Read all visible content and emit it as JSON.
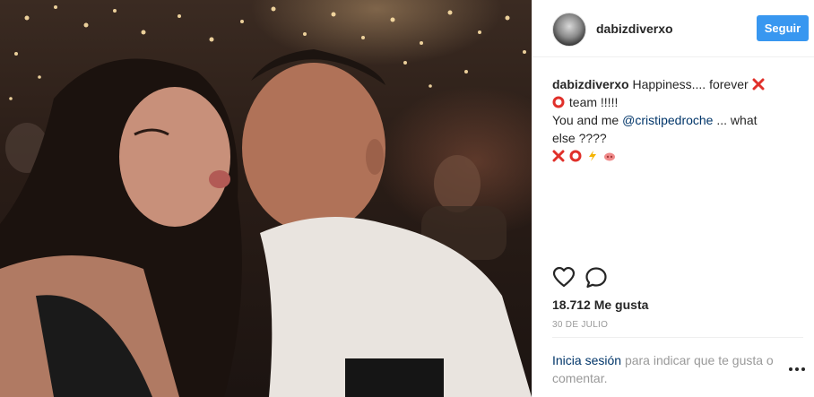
{
  "post": {
    "username": "dabizdiverxo",
    "follow_label": "Seguir",
    "caption": {
      "username": "dabizdiverxo",
      "text_1": "Happiness.... forever",
      "text_2": "team !!!!!",
      "text_3": "You and me",
      "mention": "@cristipedroche",
      "text_4": "... what else ????"
    },
    "likes_text": "18.712 Me gusta",
    "date": "30 DE JULIO",
    "login": {
      "link": "Inicia sesión",
      "text": "para indicar que te gusta o comentar."
    },
    "icons": {
      "avatar": "profile-avatar",
      "like": "heart-outline-icon",
      "comment": "speech-bubble-icon",
      "more": "ellipsis-icon",
      "emoji_cross": "red-cross-mark-icon",
      "emoji_circle": "red-circle-icon",
      "emoji_bolt": "lightning-icon",
      "emoji_pig": "pig-nose-icon"
    },
    "colors": {
      "accent": "#3897f0",
      "link": "#003569",
      "muted": "#999999",
      "emoji_red": "#e0302a",
      "emoji_bolt": "#f5b400"
    }
  }
}
